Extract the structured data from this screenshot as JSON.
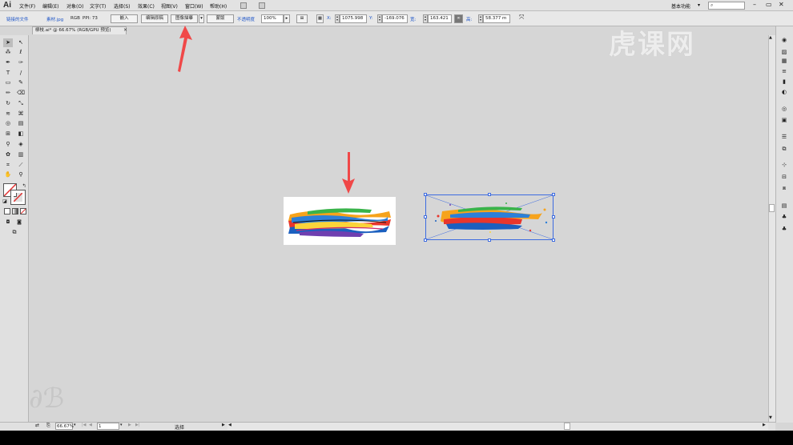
{
  "app": {
    "logo": "Ai",
    "workspace": "基本功能"
  },
  "menu": [
    "文件(F)",
    "编辑(E)",
    "对象(O)",
    "文字(T)",
    "选择(S)",
    "效果(C)",
    "视图(V)",
    "窗口(W)",
    "帮助(H)"
  ],
  "controlbar": {
    "linked_file": "链接的文件",
    "filename": "素材.jpg",
    "mode": "RGB",
    "ppi": "PPI: 73",
    "embed_label": "嵌入",
    "edit_original_label": "编辑原稿",
    "image_trace_label": "图像描摹",
    "mask_label": "蒙版",
    "opacity_label": "不透明度",
    "opacity_value": "100%",
    "x_label": "X:",
    "x_value": "1075.998",
    "y_label": "Y:",
    "y_value": "-169.076",
    "w_label": "宽:",
    "w_value": "163.421",
    "h_label": "高:",
    "h_value": "58.377 m"
  },
  "document": {
    "tab_title": "柳枝.ai* @ 66.67% (RGB/GPU 预览)"
  },
  "status": {
    "zoom": "66.67%",
    "page": "1",
    "tool": "选择"
  },
  "watermark": "虎课网",
  "colors": {
    "accent": "#1f56c8",
    "arrow": "#f04848",
    "selection": "#3d6be0"
  },
  "icons": [
    "selection-tool-icon",
    "direct-selection-tool-icon",
    "pen-tool-icon",
    "type-tool-icon",
    "line-tool-icon",
    "rectangle-tool-icon",
    "brush-tool-icon",
    "pencil-tool-icon",
    "eraser-tool-icon",
    "rotate-tool-icon",
    "scale-tool-icon",
    "width-tool-icon",
    "warp-tool-icon",
    "shape-builder-icon",
    "perspective-icon",
    "mesh-tool-icon",
    "gradient-tool-icon",
    "eyedropper-tool-icon",
    "blend-tool-icon",
    "symbol-sprayer-icon",
    "graph-tool-icon",
    "artboard-tool-icon",
    "slice-tool-icon",
    "hand-tool-icon",
    "zoom-tool-icon"
  ]
}
